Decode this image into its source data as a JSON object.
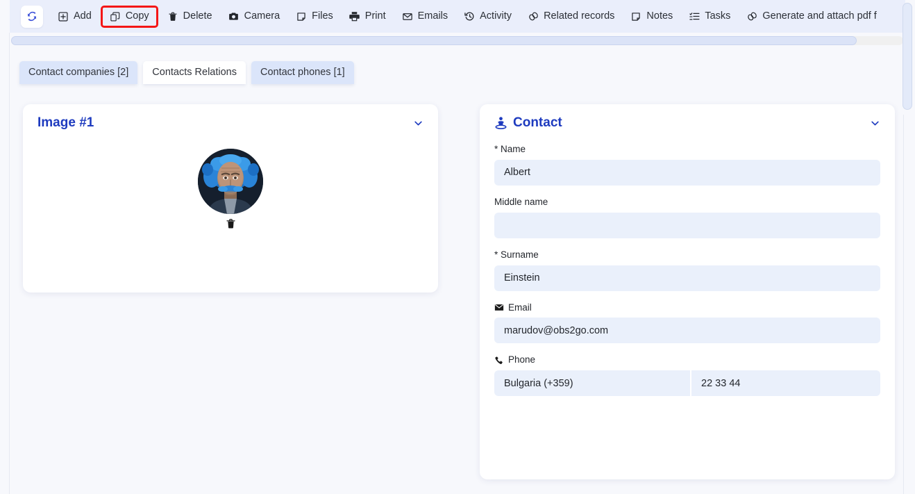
{
  "toolbar": {
    "refresh_icon": "refresh-icon",
    "items": [
      {
        "label": "Add",
        "icon": "plus-square-icon",
        "highlighted": false
      },
      {
        "label": "Copy",
        "icon": "copy-icon",
        "highlighted": true
      },
      {
        "label": "Delete",
        "icon": "trash-icon",
        "highlighted": false
      },
      {
        "label": "Camera",
        "icon": "camera-icon",
        "highlighted": false
      },
      {
        "label": "Files",
        "icon": "file-icon",
        "highlighted": false
      },
      {
        "label": "Print",
        "icon": "print-icon",
        "highlighted": false
      },
      {
        "label": "Emails",
        "icon": "envelope-icon",
        "highlighted": false
      },
      {
        "label": "Activity",
        "icon": "history-icon",
        "highlighted": false
      },
      {
        "label": "Related records",
        "icon": "link-icon",
        "highlighted": false
      },
      {
        "label": "Notes",
        "icon": "sticky-note-icon",
        "highlighted": false
      },
      {
        "label": "Tasks",
        "icon": "tasks-icon",
        "highlighted": false
      },
      {
        "label": "Generate and attach pdf f",
        "icon": "link-icon",
        "highlighted": false
      }
    ],
    "highlight_color": "#f41616"
  },
  "tabs": [
    {
      "label": "Contact companies [2]",
      "state": "active"
    },
    {
      "label": "Contacts Relations",
      "state": "inactive"
    },
    {
      "label": "Contact phones [1]",
      "state": "active"
    }
  ],
  "image_card": {
    "title": "Image #1",
    "collapse_icon": "chevron-down-icon",
    "avatar_alt": "einstein-portrait-avatar",
    "delete_icon": "trash-icon"
  },
  "contact_card": {
    "title": "Contact",
    "title_icon": "person-pedestal-icon",
    "collapse_icon": "chevron-down-icon",
    "fields": [
      {
        "label": "* Name",
        "icon": null,
        "value": "Albert",
        "type": "single"
      },
      {
        "label": "Middle name",
        "icon": null,
        "value": "",
        "type": "single"
      },
      {
        "label": "* Surname",
        "icon": null,
        "value": "Einstein",
        "type": "single"
      },
      {
        "label": "Email",
        "icon": "envelope-icon",
        "value": "marudov@obs2go.com",
        "type": "single"
      },
      {
        "label": "Phone",
        "icon": "phone-icon",
        "value": "Bulgaria (+359)",
        "value2": "22 33 44",
        "type": "split"
      }
    ]
  },
  "colors": {
    "accent": "#1e3bbf",
    "toolbar_bg": "#eaeefb",
    "page_bg": "#f7f8fc",
    "field_bg": "#eaf0fb",
    "tab_active_bg": "#dbe5fa"
  },
  "scrollbars": {
    "horizontal_thumb_percent": 95,
    "vertical_thumb_percent": 22
  }
}
